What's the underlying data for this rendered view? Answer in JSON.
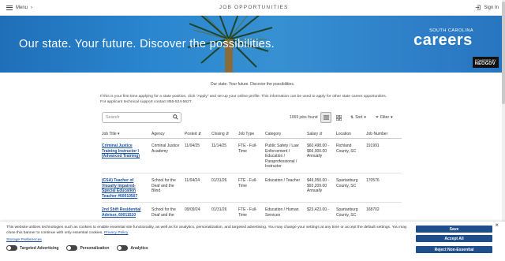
{
  "topbar": {
    "menu_label": "Menu",
    "title": "JOB OPPORTUNITIES",
    "signin_label": "Sign In"
  },
  "hero": {
    "tagline": "Our state. Your future. Discover the possibilities.",
    "logo_top": "SOUTH CAROLINA",
    "logo_main": "careers",
    "powered_by": "POWERED BY",
    "neogov": "NEOGOV"
  },
  "intro": "Our state. Your future. Discover the possibilities.",
  "info_line1": "If this is your first time applying for a state position, click \"Apply\" and set up your online profile. This information can be used to apply for other state career opportunities.",
  "info_line2": "For applicant technical support contact 855-524-5627.",
  "toolbar": {
    "search_placeholder": "Search",
    "jobs_found": "1069 jobs found",
    "sort_label": "Sort",
    "filter_label": "Filter"
  },
  "table": {
    "headers": [
      "Job Title ▾",
      "Agency",
      "Posted ⇵",
      "Closing ⇵",
      "Job Type",
      "Category",
      "Salary ⇵",
      "Location",
      "Job Number"
    ],
    "rows": [
      {
        "title": "Criminal Justice Training Instructor I (Advanced Training)",
        "agency": "Criminal Justice Academy",
        "posted": "11/04/25",
        "closing": "11/14/25",
        "type": "FTE - Full-Time",
        "category": "Public Safety / Law Enforcement / Education / Paraprofessional / Instructor",
        "salary": "$60,498.00 - $66,000.00 Annually",
        "location": "Richland County, SC",
        "number": "191991"
      },
      {
        "title": "(CSA) Teacher of Visually Impaired- Special Education Teacher #60010507",
        "agency": "School for the Deaf and the Blind",
        "posted": "11/04/24",
        "closing": "01/31/26",
        "type": "FTE - Full-Time",
        "category": "Education / Teacher",
        "salary": "$49,050.00 - $93,209.00 Annually",
        "location": "Spartanburg County, SC",
        "number": "170576"
      },
      {
        "title": "2nd Shift Residential Advisor, 60011510",
        "agency": "School for the Deaf and the",
        "posted": "09/09/24",
        "closing": "01/31/26",
        "type": "FTE - Full-Time",
        "category": "Education / Human Services",
        "salary": "$23,423.00 -",
        "location": "Spartanburg County, SC",
        "number": "168702"
      }
    ]
  },
  "cookie": {
    "text": "This website utilizes technologies such as cookies to enable essential site functionality, as well as for analytics, personalization, and targeted advertising. You may change your settings at any time or accept the default settings. You may close this banner to continue with only essential cookies.",
    "privacy_link": "Privacy Policy",
    "storage_link": "Storage Preferences",
    "toggle_ads": "Targeted Advertising",
    "toggle_personalization": "Personalization",
    "toggle_analytics": "Analytics",
    "save": "Save",
    "accept_all": "Accept All",
    "reject": "Reject Non-Essential"
  }
}
